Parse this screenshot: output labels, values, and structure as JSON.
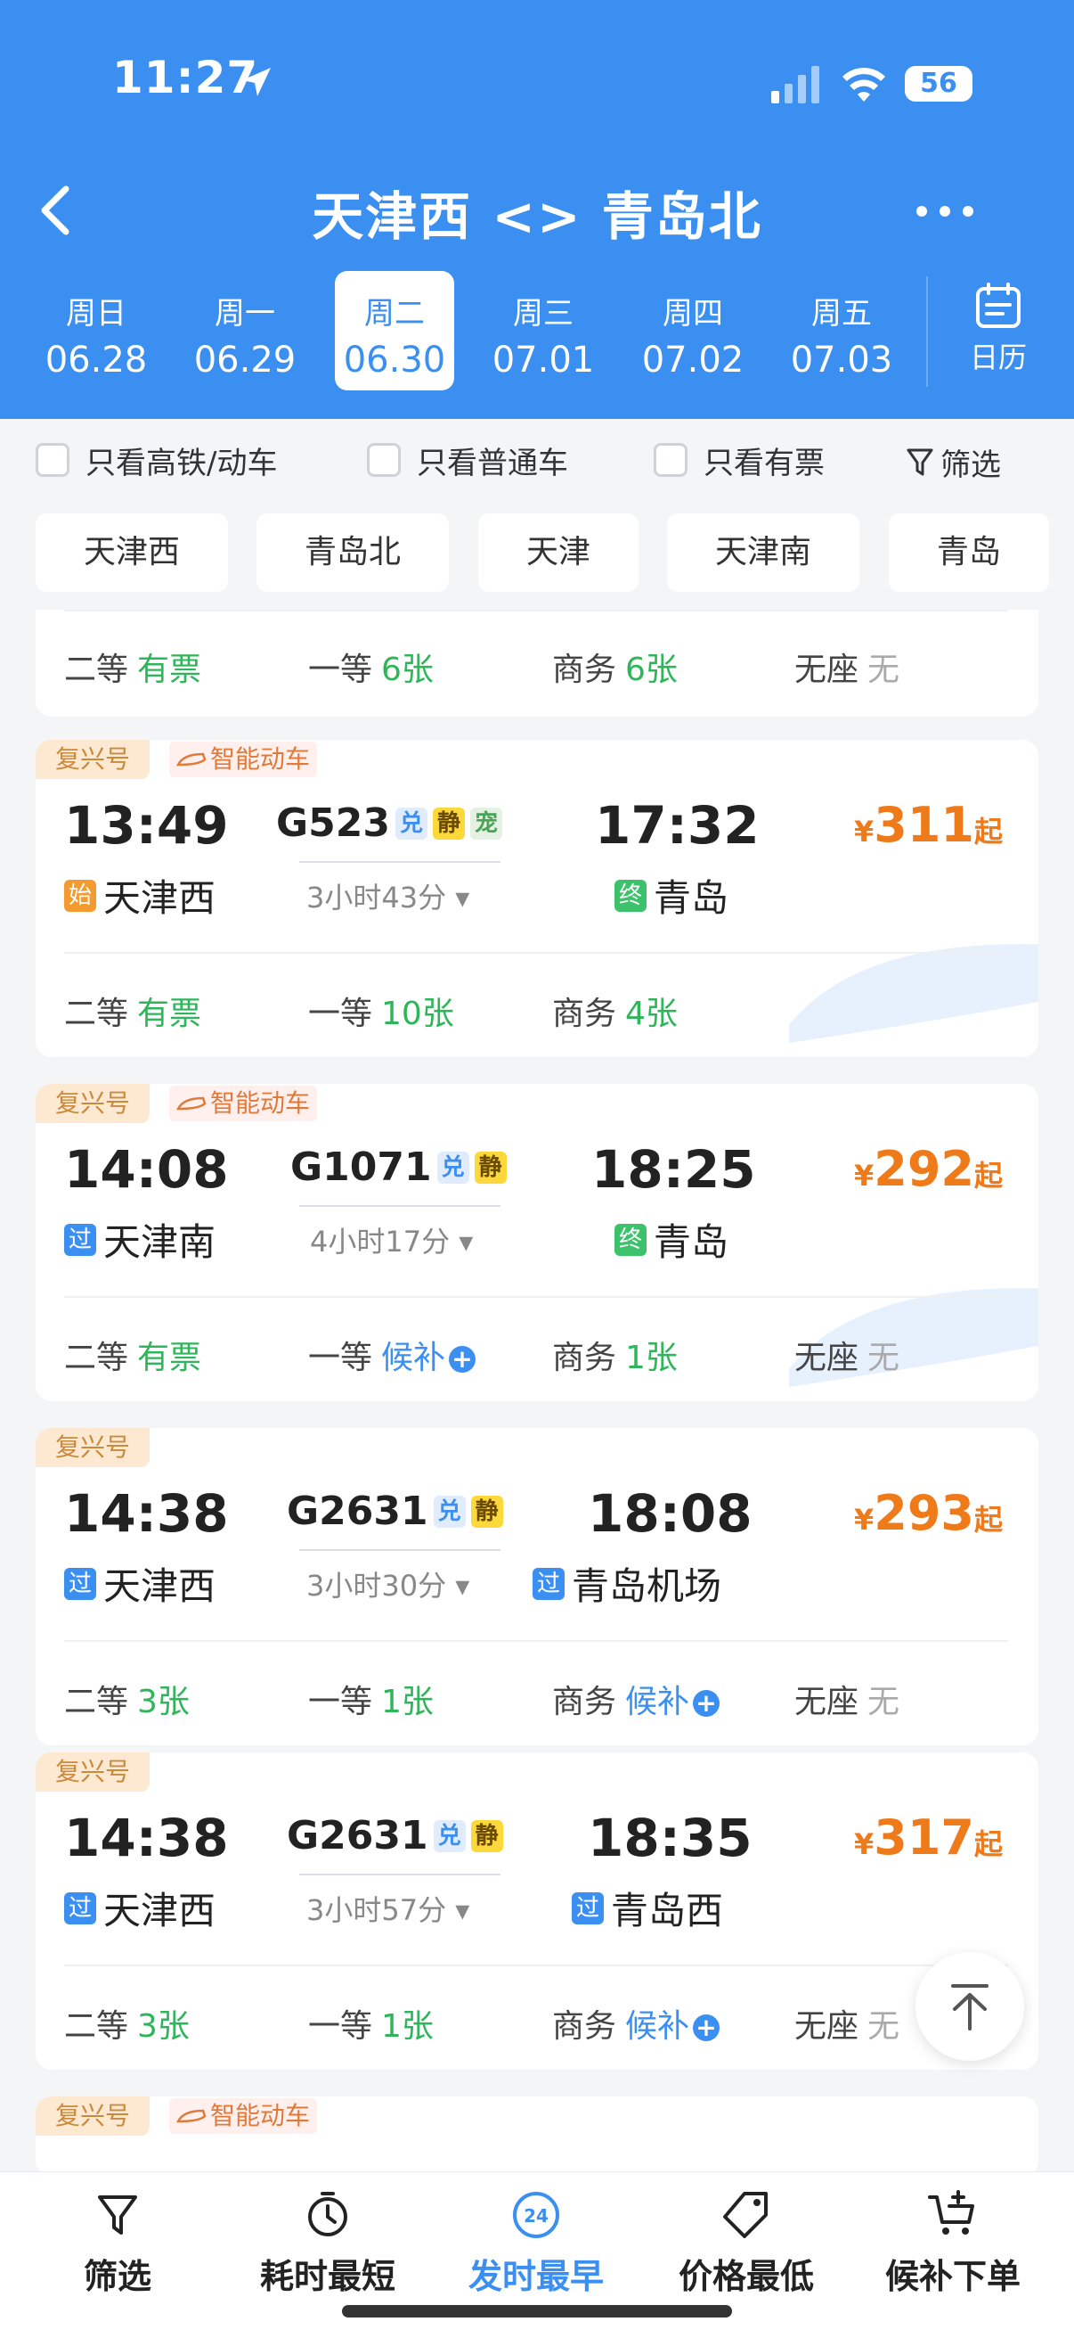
{
  "status": {
    "time": "11:27",
    "battery": "56"
  },
  "nav": {
    "title": "天津西 <> 青岛北"
  },
  "days": [
    {
      "weekday": "周日",
      "date": "06.28"
    },
    {
      "weekday": "周一",
      "date": "06.29"
    },
    {
      "weekday": "周二",
      "date": "06.30"
    },
    {
      "weekday": "周三",
      "date": "07.01"
    },
    {
      "weekday": "周四",
      "date": "07.02"
    },
    {
      "weekday": "周五",
      "date": "07.03"
    }
  ],
  "calendar_label": "日历",
  "filters": {
    "hs_only": "只看高铁/动车",
    "normal_only": "只看普通车",
    "available_only": "只看有票",
    "screen": "筛选"
  },
  "stations": [
    "天津西",
    "青岛北",
    "天津",
    "天津南",
    "青岛"
  ],
  "partial_card": {
    "seats": [
      {
        "name": "二等",
        "value": "有票"
      },
      {
        "name": "一等",
        "value": "6张"
      },
      {
        "name": "商务",
        "value": "6张"
      },
      {
        "name": "无座",
        "value": "无"
      }
    ]
  },
  "trains": [
    {
      "brand": "复兴号",
      "smart": "智能动车",
      "dep_time": "13:49",
      "arr_time": "17:32",
      "number": "G523",
      "badges": [
        "兑",
        "静",
        "宠"
      ],
      "duration": "3小时43分",
      "from_tag": "始",
      "from": "天津西",
      "to_tag": "终",
      "to": "青岛",
      "price_sym": "¥",
      "price": "311",
      "price_suffix": "起",
      "seats": [
        {
          "name": "二等",
          "value": "有票"
        },
        {
          "name": "一等",
          "value": "10张"
        },
        {
          "name": "商务",
          "value": "4张"
        }
      ]
    },
    {
      "brand": "复兴号",
      "smart": "智能动车",
      "dep_time": "14:08",
      "arr_time": "18:25",
      "number": "G1071",
      "badges": [
        "兑",
        "静"
      ],
      "duration": "4小时17分",
      "from_tag": "过",
      "from": "天津南",
      "to_tag": "终",
      "to": "青岛",
      "price_sym": "¥",
      "price": "292",
      "price_suffix": "起",
      "seats": [
        {
          "name": "二等",
          "value": "有票"
        },
        {
          "name": "一等",
          "value": "候补"
        },
        {
          "name": "商务",
          "value": "1张"
        },
        {
          "name": "无座",
          "value": "无"
        }
      ]
    },
    {
      "brand": "复兴号",
      "dep_time": "14:38",
      "arr_time": "18:08",
      "number": "G2631",
      "badges": [
        "兑",
        "静"
      ],
      "duration": "3小时30分",
      "from_tag": "过",
      "from": "天津西",
      "to_tag": "过",
      "to": "青岛机场",
      "price_sym": "¥",
      "price": "293",
      "price_suffix": "起",
      "seats": [
        {
          "name": "二等",
          "value": "3张"
        },
        {
          "name": "一等",
          "value": "1张"
        },
        {
          "name": "商务",
          "value": "候补"
        },
        {
          "name": "无座",
          "value": "无"
        }
      ]
    },
    {
      "brand": "复兴号",
      "dep_time": "14:38",
      "arr_time": "18:35",
      "number": "G2631",
      "badges": [
        "兑",
        "静"
      ],
      "duration": "3小时57分",
      "from_tag": "过",
      "from": "天津西",
      "to_tag": "过",
      "to": "青岛西",
      "price_sym": "¥",
      "price": "317",
      "price_suffix": "起",
      "seats": [
        {
          "name": "二等",
          "value": "3张"
        },
        {
          "name": "一等",
          "value": "1张"
        },
        {
          "name": "商务",
          "value": "候补"
        },
        {
          "name": "无座",
          "value": "无"
        }
      ]
    },
    {
      "brand": "复兴号",
      "smart": "智能动车"
    }
  ],
  "tabs": [
    "筛选",
    "耗时最短",
    "发时最早",
    "价格最低",
    "候补下单"
  ],
  "tab_early_badge": "24",
  "colors": {
    "primary": "#3b8ff1",
    "price": "#ef7a1a",
    "available": "#2fb55a"
  }
}
